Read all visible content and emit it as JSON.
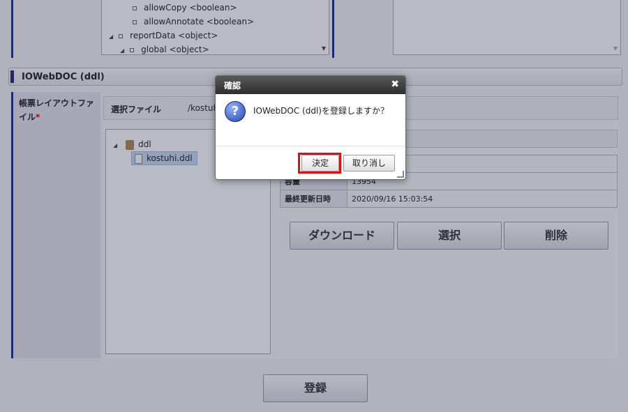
{
  "tree_top": {
    "items": [
      {
        "name": "allowCopy",
        "type": "<boolean>"
      },
      {
        "name": "allowAnnotate",
        "type": "<boolean>"
      },
      {
        "name": "reportData",
        "type": "<object>"
      },
      {
        "name": "global",
        "type": "<object>"
      }
    ]
  },
  "section": {
    "title": "IOWebDOC (ddl)"
  },
  "field": {
    "label": "帳票レイアウトファイル",
    "required_mark": "*"
  },
  "selected_file": {
    "label": "選択ファイル",
    "path": "/kostuhi"
  },
  "file_tree": {
    "folder": "ddl",
    "file": "kostuhi.ddl"
  },
  "info": {
    "rows": [
      {
        "key": "容量",
        "value": "13954"
      },
      {
        "key": "最終更新日時",
        "value": "2020/09/16 15:03:54"
      }
    ]
  },
  "actions": {
    "download": "ダウンロード",
    "select": "選択",
    "delete": "削除"
  },
  "register_label": "登録",
  "dialog": {
    "title": "確認",
    "close_glyph": "✖",
    "icon_glyph": "?",
    "message": "IOWebDOC (ddl)を登録しますか？",
    "ok_label": "決定",
    "cancel_label": "取り消し"
  },
  "colors": {
    "accent": "#1a2a8a",
    "highlight": "#e01010"
  }
}
